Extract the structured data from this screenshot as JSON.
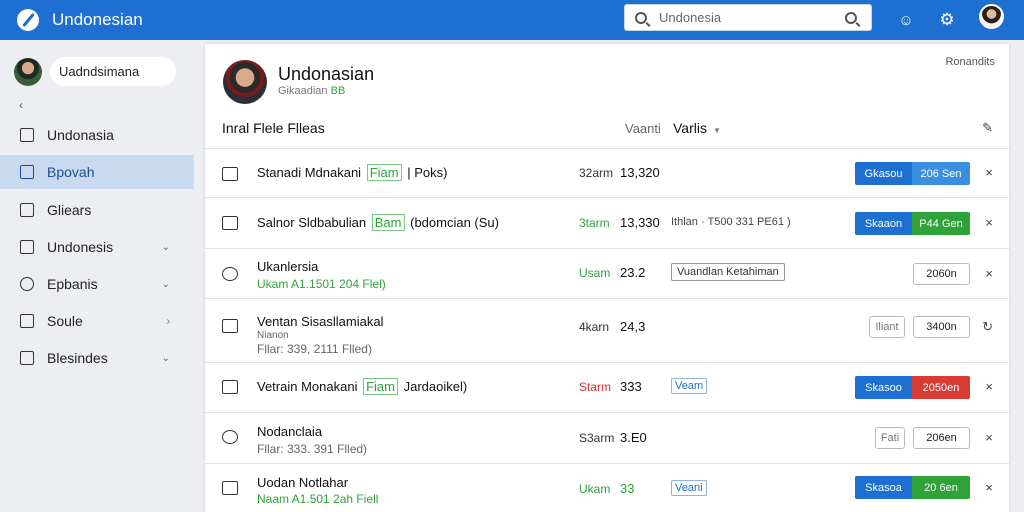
{
  "app": {
    "title": "Undonesian"
  },
  "search": {
    "value": "Undonesia"
  },
  "sidebar": {
    "user_name": "Uadndsimana",
    "collapse_glyph": "‹",
    "items": [
      {
        "label": "Undonasia",
        "icon": "home-icon",
        "caret": ""
      },
      {
        "label": "Bpovah",
        "icon": "edit-icon",
        "caret": ""
      },
      {
        "label": "Gliears",
        "icon": "folder-icon",
        "caret": ""
      },
      {
        "label": "Undonesis",
        "icon": "file-icon",
        "caret": "⌄"
      },
      {
        "label": "Epbanis",
        "icon": "user-icon",
        "caret": "⌄"
      },
      {
        "label": "Soule",
        "icon": "settings-icon",
        "caret": "›"
      },
      {
        "label": "Blesindes",
        "icon": "gear-icon",
        "caret": "⌄"
      }
    ]
  },
  "profile": {
    "name": "Undonasian",
    "sub_prefix": "Gikaadian",
    "sub_highlight": "BB",
    "corner_link": "Ronandits"
  },
  "files": {
    "heading": "Inral Flele Flleas",
    "col1": "Vaanti",
    "col2": "Varlis",
    "rows": [
      {
        "title_pre": "Stanadi Mdnakani",
        "tag": "Fiam",
        "title_post": "| Poks)",
        "sub": "",
        "time": "32arm",
        "time_color": "",
        "value": "13,320",
        "value_color": "",
        "note": "",
        "badge": "",
        "box": "",
        "btn_a": "Gkasou",
        "btn_b": "206 Sen",
        "btn_b_color": "blue",
        "btn_single": "",
        "btn_small": "",
        "close": "×"
      },
      {
        "title_pre": "Salnor Sldbabulian",
        "tag": "Bam",
        "title_post": "(bdomcian (Su)",
        "sub": "",
        "time": "3tarm",
        "time_color": "green",
        "value": "13,330",
        "value_color": "",
        "note": "Ithlan · T500 331 PE61 )",
        "badge": "",
        "box": "",
        "btn_a": "Skaaon",
        "btn_b": "P44 Gen",
        "btn_b_color": "green",
        "btn_single": "",
        "btn_small": "",
        "close": "×"
      },
      {
        "title_pre": "Ukanlersia",
        "tag": "",
        "title_post": "",
        "sub": "Ukam A1.1501 204 Flel)",
        "sub_color": "green",
        "time": "Usam",
        "time_color": "green",
        "value": "23.2",
        "value_color": "",
        "note": "",
        "badge": "",
        "box": "Vuandlan Ketahiman",
        "btn_a": "",
        "btn_b": "",
        "btn_b_color": "",
        "btn_single": "2060n",
        "btn_small": "",
        "close": "×"
      },
      {
        "title_pre": "Ventan Sisasllamiakal",
        "tag": "",
        "title_post": "",
        "sub_top": "Nianon",
        "sub": "Fllar: 339, 2111 Flled)",
        "sub_color": "",
        "time": "4karn",
        "time_color": "",
        "value": "24,3",
        "value_color": "",
        "note": "",
        "badge": "",
        "box": "",
        "btn_a": "",
        "btn_b": "",
        "btn_b_color": "",
        "btn_single": "3400n",
        "btn_small": "Iliant",
        "close": "↻"
      },
      {
        "title_pre": "Vetrain Monakani",
        "tag": "Fiam",
        "title_post": "Jardaoikel)",
        "sub": "",
        "time": "Starm",
        "time_color": "red",
        "value": "333",
        "value_color": "",
        "note": "",
        "badge": "Veam",
        "box": "",
        "btn_a": "Skasoo",
        "btn_b": "2050en",
        "btn_b_color": "red",
        "btn_single": "",
        "btn_small": "",
        "close": "×"
      },
      {
        "title_pre": "Nodanclaia",
        "tag": "",
        "title_post": "",
        "sub": "Fllar: 333. 391 Flled)",
        "sub_color": "",
        "time": "S3arm",
        "time_color": "",
        "value": "3.E0",
        "value_color": "",
        "note": "",
        "badge": "",
        "box": "",
        "btn_a": "",
        "btn_b": "",
        "btn_b_color": "",
        "btn_single": "206en",
        "btn_small": "Fati",
        "close": "×"
      },
      {
        "title_pre": "Uodan Notlahar",
        "tag": "",
        "title_post": "",
        "sub": "Naam A1.501 2ah Fiell",
        "sub_color": "green",
        "time": "Ukam",
        "time_color": "green",
        "value": "33",
        "value_color": "green",
        "note": "",
        "badge": "Veani",
        "box": "",
        "btn_a": "Skasoa",
        "btn_b": "20 6en",
        "btn_b_color": "green",
        "btn_single": "",
        "btn_small": "",
        "close": "×"
      }
    ]
  },
  "colors": {
    "brand": "#1d6fd1",
    "accent_green": "#2fa33a",
    "alert_red": "#d93b35",
    "active_nav": "#c8d9f0"
  }
}
